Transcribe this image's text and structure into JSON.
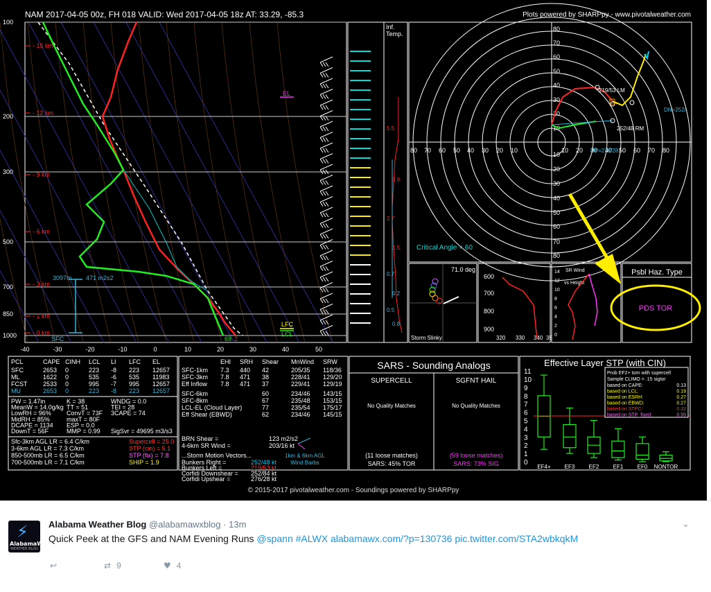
{
  "header": {
    "title": "NAM 2017-04-05 00z, FH 018    VALID: Wed 2017-04-05 18z    AT: 33.29, -85.3",
    "powered": "Plots powered by SHARPpy - www.pivotalweather.com"
  },
  "skewt": {
    "p_ticks": [
      "100",
      "200",
      "300",
      "500",
      "700",
      "850",
      "1000"
    ],
    "t_ticks": [
      "-40",
      "-30",
      "-20",
      "-10",
      "0",
      "10",
      "20",
      "30",
      "40",
      "50"
    ],
    "km_labels": [
      "15 km",
      "12 km",
      "9 km",
      "6 km",
      "3 km",
      "1 km",
      "0 km"
    ],
    "el": "EL",
    "lfc": "LFC",
    "lcl": "LCL",
    "sfc": "SFC",
    "eff_layer": "3097m",
    "eff_srh": "471 m2s2",
    "sfc_temp": "69",
    "sfc_dew": "2",
    "infl_label_1": "Inf.",
    "infl_label_2": "Temp.",
    "infl_values": [
      "5.5",
      "3.9",
      "2.7",
      "1.5",
      "0.7",
      "0.2",
      "0.5",
      "0.8"
    ]
  },
  "hodo": {
    "y_labels": [
      "80",
      "70",
      "60",
      "50",
      "40",
      "30",
      "20",
      "10",
      "10",
      "20",
      "30",
      "40",
      "50",
      "60",
      "70",
      "80"
    ],
    "x_labels": [
      "80",
      "70",
      "60",
      "50",
      "40",
      "30",
      "20",
      "10",
      "10",
      "20",
      "30",
      "40",
      "50",
      "60",
      "70",
      "80"
    ],
    "lm": "219/53 LM",
    "rm": "252/48 RM",
    "dn": "DN=252/",
    "up": "UP=276/28",
    "crit": "Critical Angle = 60"
  },
  "slinky": {
    "angle": "71.0 deg",
    "label": "Storm Slinky",
    "p_ticks": [
      "600",
      "700",
      "800",
      "900"
    ],
    "t_ticks": [
      "320",
      "330",
      "340",
      "35"
    ]
  },
  "srwind": {
    "label_1": "SR Wind",
    "label_2": "vs Height",
    "h_ticks": [
      "14",
      "12",
      "10",
      "8",
      "6",
      "4",
      "2",
      "0"
    ]
  },
  "haz": {
    "title": "Psbl Haz. Type",
    "value": "PDS TOR"
  },
  "parcels": {
    "headers": [
      "PCL",
      "CAPE",
      "CINH",
      "LCL",
      "LI",
      "LFC",
      "EL"
    ],
    "rows": [
      [
        "SFC",
        "2653",
        "0",
        "223",
        "-8",
        "223",
        "12657"
      ],
      [
        "ML",
        "1622",
        "0",
        "535",
        "-6",
        "535",
        "11983"
      ],
      [
        "FCST",
        "2533",
        "0",
        "995",
        "-7",
        "995",
        "12657"
      ],
      [
        "MU",
        "2653",
        "0",
        "223",
        "-8",
        "223",
        "12657"
      ]
    ]
  },
  "indices": [
    [
      "PW = 1.47in",
      "K = 38",
      "WNDG = 0.0"
    ],
    [
      "MeanW = 14.0g/kg",
      "TT = 51",
      "TEI = 28"
    ],
    [
      "LowRH = 96%",
      "ConvT = 73F",
      "3CAPE = 74"
    ],
    [
      "MidRH = 85%",
      "maxT = 80F",
      ""
    ],
    [
      "DCAPE = 1134",
      "ESP = 0.0",
      ""
    ],
    [
      "DownT = 56F",
      "MMP = 0.99",
      "SigSvr = 49695 m3/s3"
    ]
  ],
  "lapse": [
    "Sfc-3km AGL LR = 6.4 C/km",
    "3-6km AGL LR = 7.3 C/km",
    "850-500mb LR = 6.5 C/km",
    "700-500mb LR = 7.1 C/km"
  ],
  "comp": [
    {
      "text": "Supercell = 25.0",
      "color": "#ff3333"
    },
    {
      "text": "STP (cin) = 5.1",
      "color": "#ff3333"
    },
    {
      "text": "STP (fix) = 7.8",
      "color": "#ff66ff"
    },
    {
      "text": "SHIP = 1.9",
      "color": "#ffff00"
    }
  ],
  "kin": {
    "headers": [
      "EHI",
      "SRH",
      "Shear",
      "MnWind",
      "SRW"
    ],
    "rows": [
      [
        "SFC-1km",
        "7.3",
        "440",
        "42",
        "205/35",
        "118/36"
      ],
      [
        "SFC-3km",
        "7.8",
        "471",
        "38",
        "228/41",
        "129/20"
      ],
      [
        "Eff Inflow",
        "7.8",
        "471",
        "37",
        "229/41",
        "129/19"
      ],
      [
        "SFC-6km",
        "",
        "",
        "60",
        "234/46",
        "143/15"
      ],
      [
        "SFC-8km",
        "",
        "",
        "67",
        "235/48",
        "153/15"
      ],
      [
        "LCL-EL (Cloud Layer)",
        "",
        "",
        "77",
        "235/54",
        "175/17"
      ],
      [
        "Eff Shear (EBWD)",
        "",
        "",
        "62",
        "234/46",
        "145/15"
      ]
    ],
    "brn": "BRN Shear =",
    "brn_v": "123 m2/s2",
    "srw46": "4-6km SR Wind =",
    "srw46_v": "203/16 kt",
    "motion_title": "...Storm Motion Vectors...",
    "motion": [
      [
        "Bunkers Right =",
        "252/48 kt",
        "#00ccff"
      ],
      [
        "Bunkers Left =",
        "219/53 kt",
        "#ff3333"
      ],
      [
        "Corfidi Downshear =",
        "252/84 kt",
        "#ffffff"
      ],
      [
        "Corfidi Upshear =",
        "276/28 kt",
        "#ffffff"
      ]
    ],
    "barbs": "1km & 6km AGL",
    "barbs2": "Wind Barbs"
  },
  "sars": {
    "title": "SARS - Sounding Analogs",
    "sc": "SUPERCELL",
    "hail": "SGFNT HAIL",
    "nq": "No Quality Matches",
    "sc_loose": "(11 loose matches)",
    "hail_loose": "(59 loose matches)",
    "sc_pct": "SARS: 45% TOR",
    "hail_pct": "SARS: 73% SIG"
  },
  "stp": {
    "title": "Effective Layer STP (with CIN)",
    "y_ticks": [
      "11",
      "10",
      "9",
      "8",
      "7",
      "6",
      "5",
      "4",
      "3",
      "2",
      "1",
      "0"
    ],
    "cats": [
      "EF4+",
      "EF3",
      "EF2",
      "EF1",
      "EF0",
      "NONTOR"
    ],
    "prob_title": "Prob EF2+ torn with supercell",
    "prob_sub": "Sample CLIMO = .15 sigtor",
    "prob": [
      [
        "based on CAPE:",
        "0.13",
        "#ffffff"
      ],
      [
        "based on LCL:",
        "0.19",
        "#ffff00"
      ],
      [
        "based on ESRH:",
        "0.27",
        "#ffff00"
      ],
      [
        "based on EBWD:",
        "0.27",
        "#ffff00"
      ],
      [
        "based on STPC:",
        "0.32",
        "#ff3333"
      ],
      [
        "based on STP_fixed:",
        "0.55",
        "#ff66ff"
      ]
    ]
  },
  "footer": {
    "copy": "© 2015-2017 pivotalweather.com - Soundings powered by SHARPpy"
  },
  "tweet": {
    "avatar_brand": "AlabamaWx",
    "avatar_sub": "WEATHER BLOG",
    "name": "Alabama Weather Blog",
    "handle": "@alabamawxblog",
    "sep": "·",
    "time": "13m",
    "text_plain": "Quick Peek at the GFS and NAM Evening Runs ",
    "link1": "@spann",
    "link2": "#ALWX",
    "link3": "alabamawx.com/?p=130736",
    "link4": "pic.twitter.com/STA2wbkqkM",
    "retweets": "9",
    "likes": "4"
  }
}
